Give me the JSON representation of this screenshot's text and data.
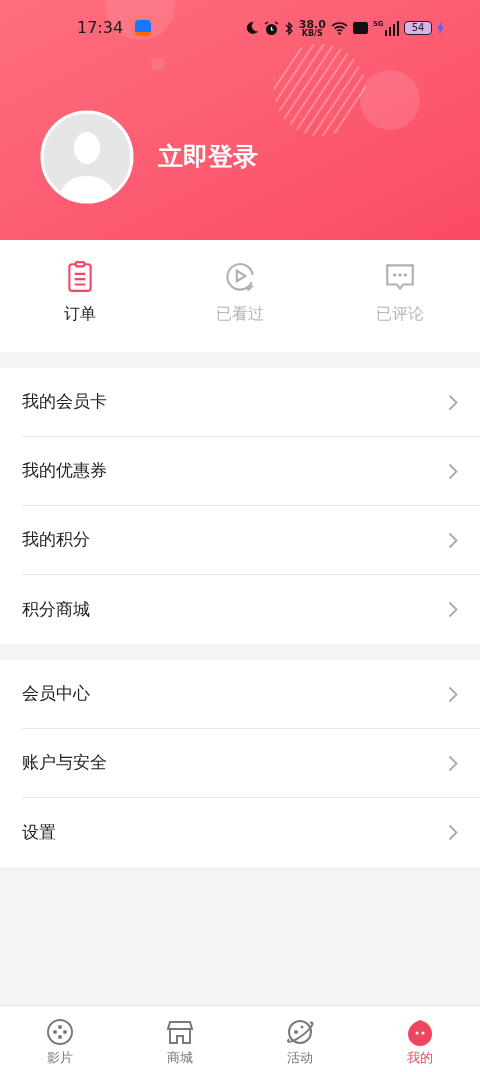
{
  "status_bar": {
    "time": "17:34",
    "speed_value": "38.0",
    "speed_unit": "KB/S",
    "network": "5G",
    "battery": "54"
  },
  "profile": {
    "login_text": "立即登录"
  },
  "quick_actions": [
    {
      "kind": "order",
      "label": "订单",
      "active": true
    },
    {
      "kind": "watched",
      "label": "已看过",
      "active": false
    },
    {
      "kind": "reviewed",
      "label": "已评论",
      "active": false
    }
  ],
  "menu_groups": [
    {
      "items": [
        {
          "label": "我的会员卡"
        },
        {
          "label": "我的优惠券"
        },
        {
          "label": "我的积分"
        },
        {
          "label": "积分商城"
        }
      ]
    },
    {
      "items": [
        {
          "label": "会员中心"
        },
        {
          "label": "账户与安全"
        },
        {
          "label": "设置"
        }
      ]
    }
  ],
  "tab_bar": [
    {
      "kind": "film",
      "label": "影片",
      "selected": false
    },
    {
      "kind": "shop",
      "label": "商城",
      "selected": false
    },
    {
      "kind": "activity",
      "label": "活动",
      "selected": false
    },
    {
      "kind": "mine",
      "label": "我的",
      "selected": true
    }
  ]
}
